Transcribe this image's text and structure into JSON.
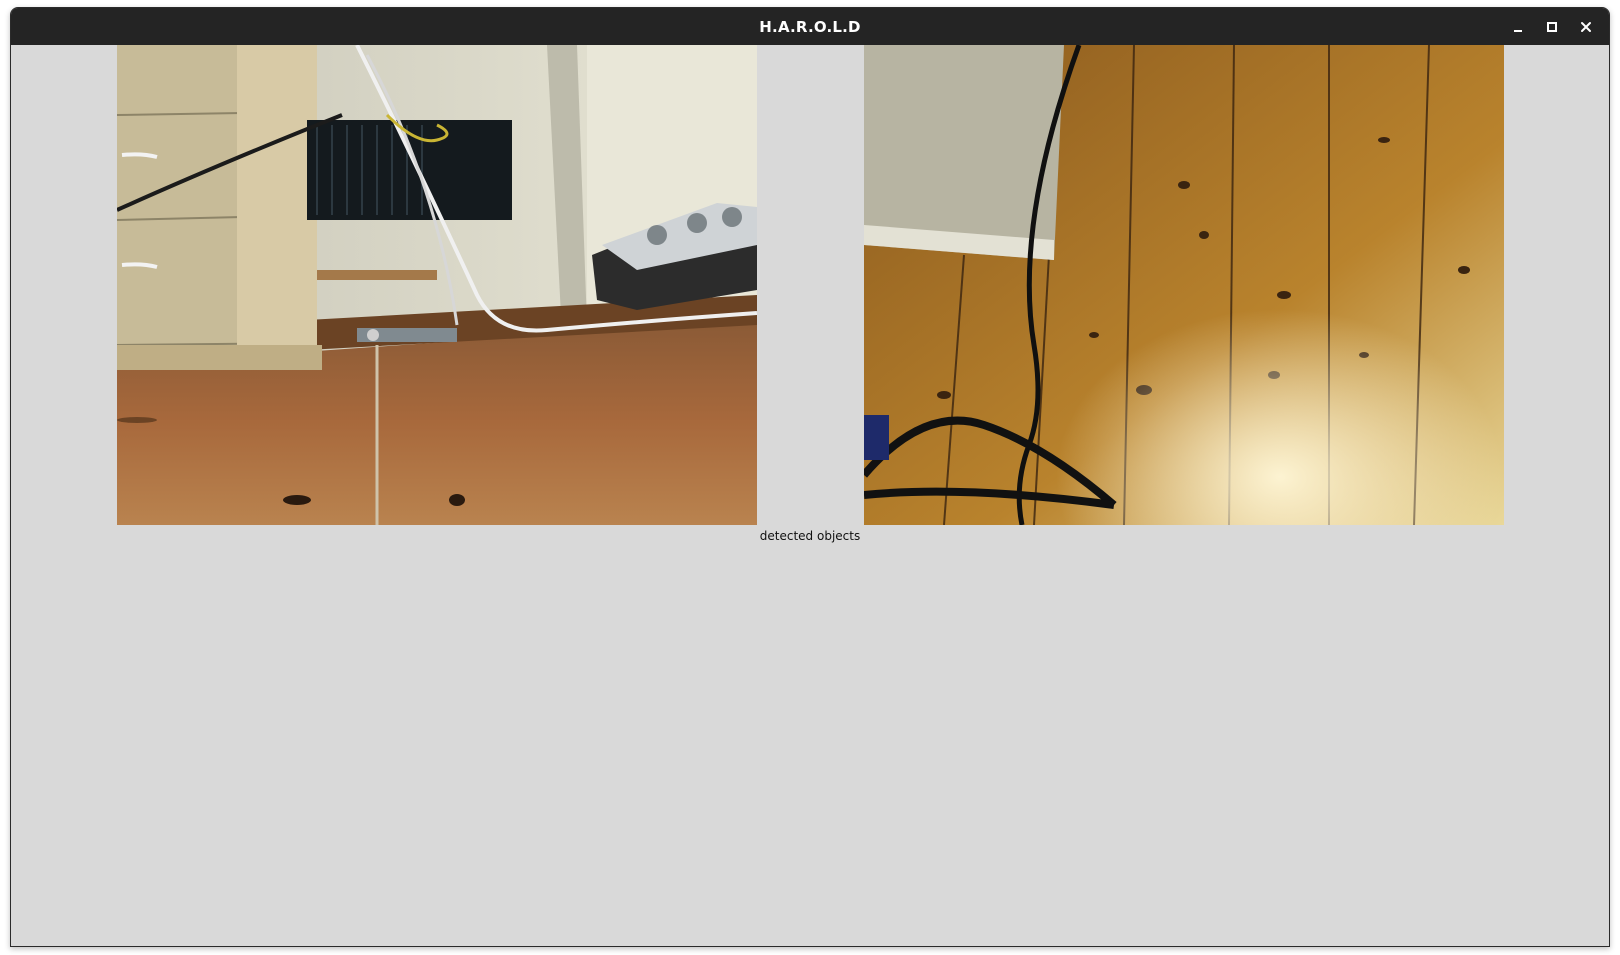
{
  "window": {
    "title": "H.A.R.O.L.D",
    "controls": [
      {
        "name": "minimize",
        "icon": "minimize-icon"
      },
      {
        "name": "maximize",
        "icon": "maximize-icon"
      },
      {
        "name": "close",
        "icon": "close-icon"
      }
    ]
  },
  "feeds": {
    "left": {
      "description_icon": "camera-feed-image"
    },
    "right": {
      "description_icon": "camera-feed-image"
    }
  },
  "caption": "detected objects",
  "colors": {
    "titlebar": "#242424",
    "window_background": "#d9d9d9",
    "title_text": "#ffffff"
  }
}
